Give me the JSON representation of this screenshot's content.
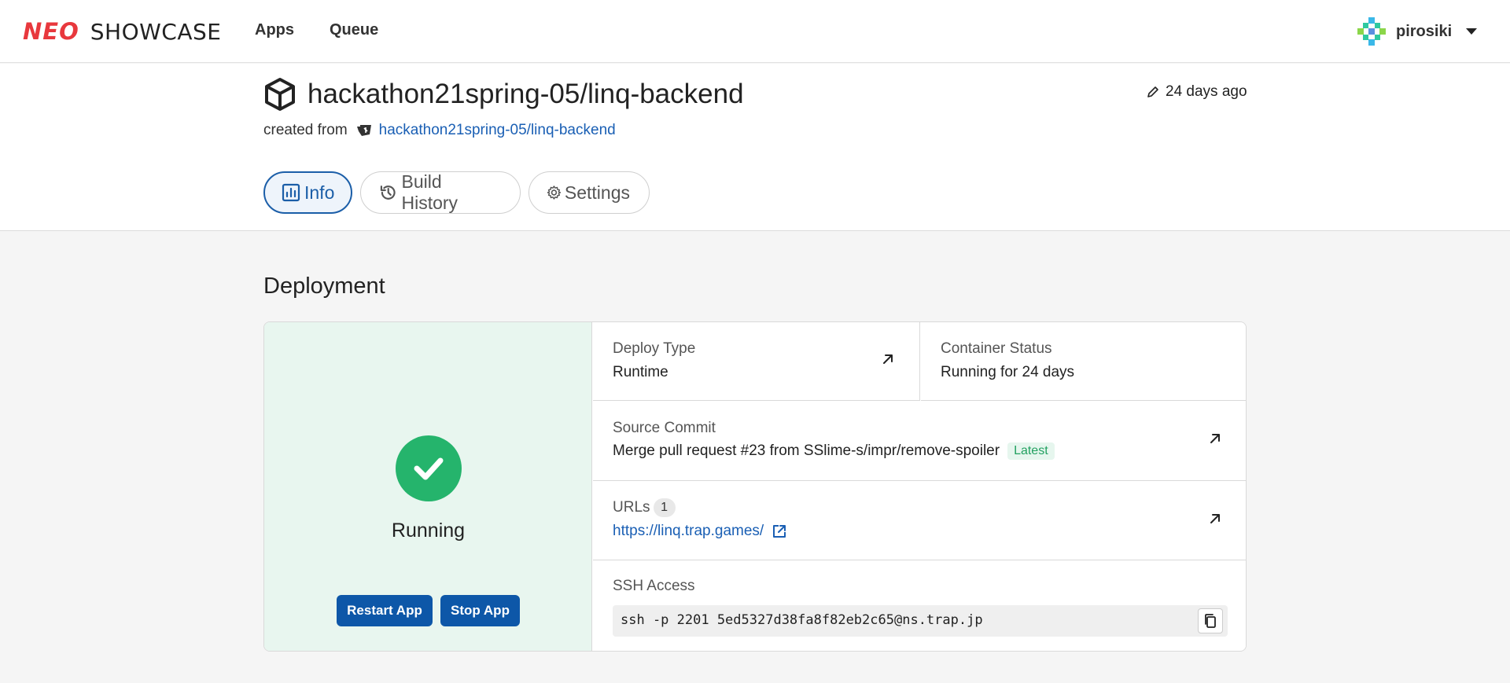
{
  "nav": {
    "logo_neo": "NEO",
    "logo_showcase": "SHOWCASE",
    "apps": "Apps",
    "queue": "Queue",
    "user": "pirosiki",
    "avatar_colors": [
      "#3ab8e8",
      "#8bd64a",
      "#2fc9a0",
      "#5a8fe0"
    ]
  },
  "header": {
    "title": "hackathon21spring-05/linq-backend",
    "updated": "24 days ago",
    "created_from_label": "created from",
    "repo_link": "hackathon21spring-05/linq-backend",
    "tabs": [
      {
        "label": "Info",
        "icon": "chart-bar-icon",
        "active": true
      },
      {
        "label": "Build History",
        "icon": "history-icon",
        "active": false
      },
      {
        "label": "Settings",
        "icon": "gear-icon",
        "active": false
      }
    ]
  },
  "deployment": {
    "heading": "Deployment",
    "status": "Running",
    "restart_label": "Restart App",
    "stop_label": "Stop App",
    "deploy_type_label": "Deploy Type",
    "deploy_type_value": "Runtime",
    "container_status_label": "Container Status",
    "container_status_value": "Running for 24 days",
    "source_commit_label": "Source Commit",
    "source_commit_value": "Merge pull request #23 from SSlime-s/impr/remove-spoiler",
    "latest_badge": "Latest",
    "urls_label": "URLs",
    "urls_count": "1",
    "url": "https://linq.trap.games/",
    "ssh_label": "SSH Access",
    "ssh_command": "ssh -p 2201 5ed5327d38fa8f82eb2c65@ns.trap.jp"
  },
  "colors": {
    "brand_red": "#e8383d",
    "primary_blue": "#0d57a8",
    "success_green": "#25b46c",
    "link_blue": "#1a5fb4"
  }
}
